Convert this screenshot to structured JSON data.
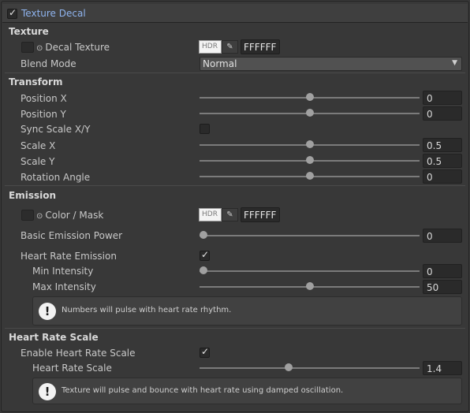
{
  "header": {
    "checkbox_checked": true,
    "title": "Texture Decal"
  },
  "sections": {
    "texture": "Texture",
    "transform": "Transform",
    "emission": "Emission",
    "heart_rate_scale": "Heart Rate Scale"
  },
  "texture": {
    "decal_label": "Decal Texture",
    "hdr_label": "HDR",
    "decal_color_hex": "FFFFFF",
    "blend_mode_label": "Blend Mode",
    "blend_mode_value": "Normal"
  },
  "transform": {
    "position_x": {
      "label": "Position X",
      "value": "0",
      "fraction": 0.5
    },
    "position_y": {
      "label": "Position Y",
      "value": "0",
      "fraction": 0.5
    },
    "sync_scale": {
      "label": "Sync Scale X/Y",
      "checked": false
    },
    "scale_x": {
      "label": "Scale X",
      "value": "0.5",
      "fraction": 0.5
    },
    "scale_y": {
      "label": "Scale Y",
      "value": "0.5",
      "fraction": 0.5
    },
    "rotation": {
      "label": "Rotation Angle",
      "value": "0",
      "fraction": 0.5
    }
  },
  "emission": {
    "color_mask_label": "Color / Mask",
    "hdr_label": "HDR",
    "color_hex": "FFFFFF",
    "basic_power": {
      "label": "Basic Emission Power",
      "value": "0",
      "fraction": 0.0
    },
    "heart_rate_emission": {
      "label": "Heart Rate Emission",
      "checked": true
    },
    "min_intensity": {
      "label": "Min Intensity",
      "value": "0",
      "fraction": 0.0
    },
    "max_intensity": {
      "label": "Max Intensity",
      "value": "50",
      "fraction": 0.5
    },
    "info_text": "Numbers will pulse with heart rate rhythm."
  },
  "heart_rate": {
    "enable": {
      "label": "Enable Heart Rate Scale",
      "checked": true
    },
    "scale": {
      "label": "Heart Rate Scale",
      "value": "1.4",
      "fraction": 0.4
    },
    "info_text": "Texture will pulse and bounce with heart rate using damped oscillation."
  },
  "icons": {
    "header_checkbox": "checkbox-icon",
    "eyedropper": "eyedropper-icon",
    "dropdown_arrow": "chevron-down-icon",
    "info": "exclamation-info-icon",
    "object_picker": "object-picker-icon"
  },
  "colors": {
    "background": "#383838",
    "header_title": "#8fb4ef",
    "field_bg": "#2a2a2a",
    "slider_thumb": "#a0a0a0",
    "info_icon_bg": "#f2f2f2"
  }
}
